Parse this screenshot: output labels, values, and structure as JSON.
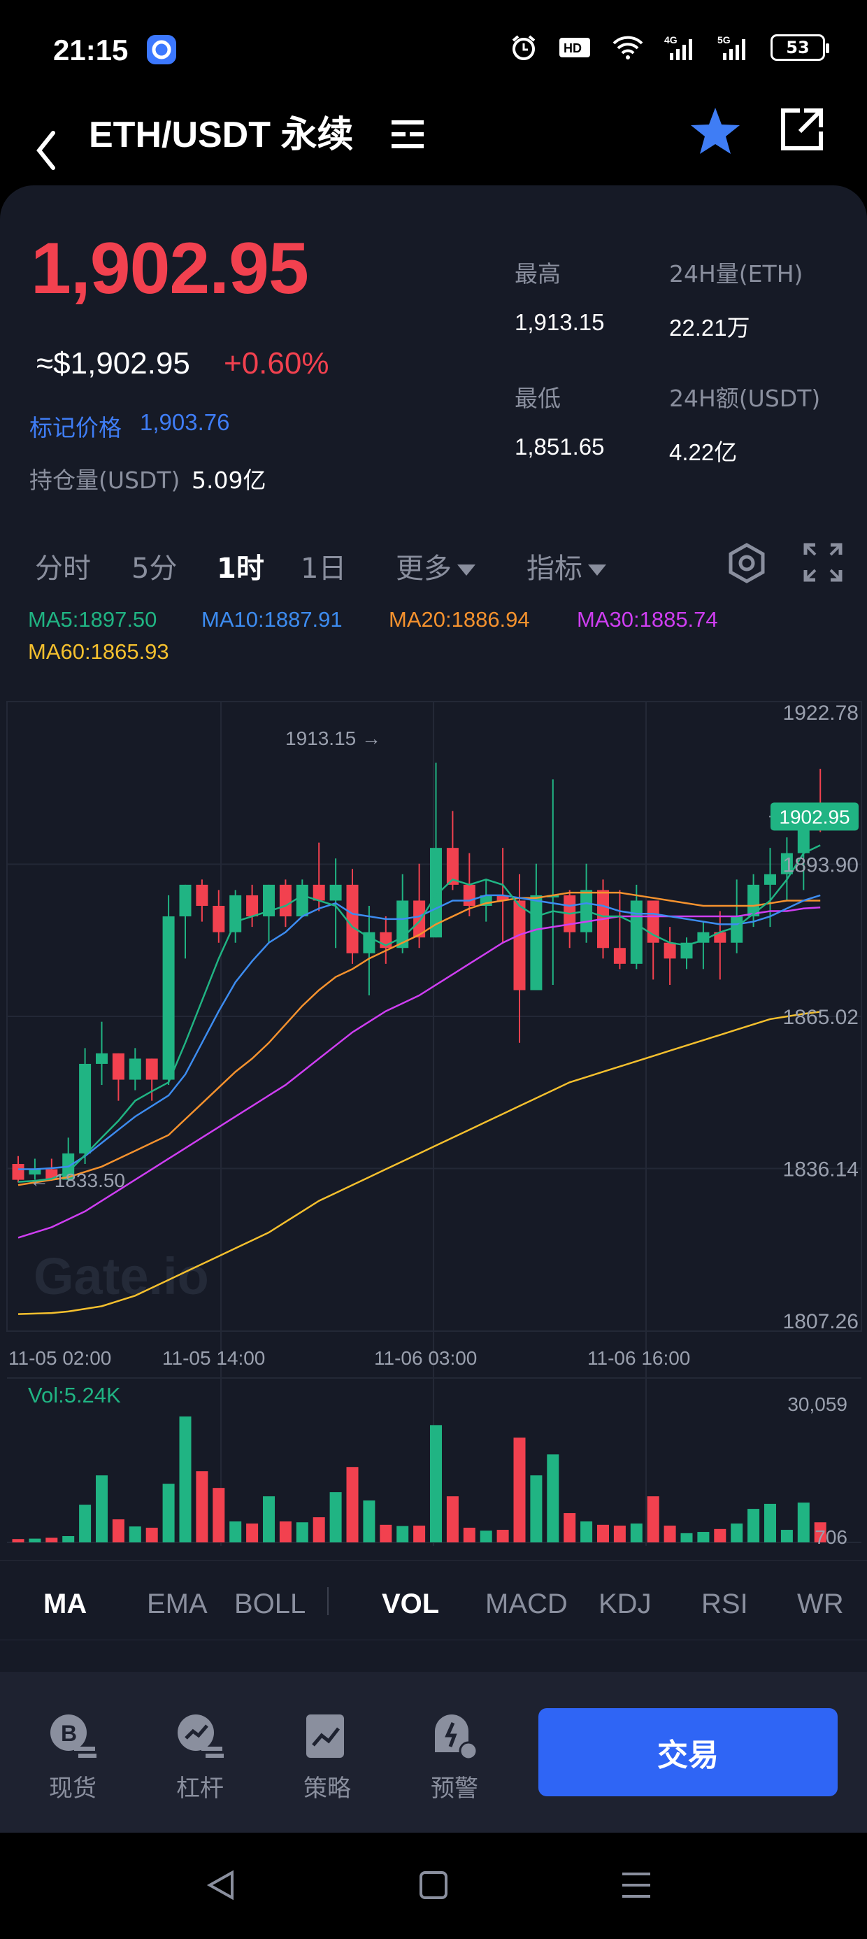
{
  "status_bar": {
    "time": "21:15",
    "battery": "53",
    "indicators": [
      "alarm-icon",
      "hd-icon",
      "wifi-icon",
      "4g-signal-icon",
      "5g-signal-icon"
    ]
  },
  "header": {
    "title": "ETH/USDT 永续",
    "icons": [
      "back-arrow-icon",
      "menu-lines-icon",
      "star-icon",
      "share-icon"
    ]
  },
  "ticker": {
    "last_price": "1,902.95",
    "usd_price": "≈$1,902.95",
    "change_pct": "+0.60%",
    "mark_label": "标记价格",
    "mark_value": "1,903.76",
    "open_interest_label": "持仓量(USDT)",
    "open_interest_value": "5.09亿",
    "high_label": "最高",
    "high_value": "1,913.15",
    "low_label": "最低",
    "low_value": "1,851.65",
    "vol_eth_label": "24H量(ETH)",
    "vol_eth_value": "22.21万",
    "vol_usdt_label": "24H额(USDT)",
    "vol_usdt_value": "4.22亿"
  },
  "periods": {
    "items": [
      "分时",
      "5分",
      "1时",
      "1日"
    ],
    "active": "1时",
    "more": "更多",
    "indicator": "指标"
  },
  "ma_legend": {
    "ma5": "MA5:1897.50",
    "ma10": "MA10:1887.91",
    "ma20": "MA20:1886.94",
    "ma30": "MA30:1885.74",
    "ma60": "MA60:1865.93"
  },
  "chart_data": {
    "type": "candlestick",
    "interval": "1h",
    "watermark": "Gate.io",
    "y_ticks": [
      "1922.78",
      "1893.90",
      "1865.02",
      "1836.14",
      "1807.26"
    ],
    "ylim": [
      1807.26,
      1922.78
    ],
    "x_ticks": [
      "11-05 02:00",
      "11-05 14:00",
      "11-06 03:00",
      "11-06 16:00"
    ],
    "last_price_tag": "1902.95",
    "high_annotation": "1913.15 →",
    "low_annotation": "← 1833.50",
    "colors": {
      "up": "#20b483",
      "down": "#f2414f",
      "ma5": "#20b483",
      "ma10": "#3d8cf0",
      "ma20": "#f5922e",
      "ma30": "#cf3ef2",
      "ma60": "#f5c02e"
    },
    "candles": [
      [
        1837,
        1834,
        1838.5,
        1833.5
      ],
      [
        1835,
        1836,
        1838,
        1834
      ],
      [
        1836,
        1834,
        1838,
        1833.8
      ],
      [
        1834,
        1839,
        1842,
        1833.8
      ],
      [
        1839,
        1856,
        1859,
        1837
      ],
      [
        1856,
        1858,
        1864,
        1852
      ],
      [
        1858,
        1853,
        1858,
        1849
      ],
      [
        1853,
        1857,
        1859,
        1851
      ],
      [
        1857,
        1853,
        1857,
        1849
      ],
      [
        1853,
        1884,
        1888,
        1852
      ],
      [
        1884,
        1890,
        1890,
        1876
      ],
      [
        1890,
        1886,
        1891,
        1883
      ],
      [
        1886,
        1881,
        1889,
        1879
      ],
      [
        1881,
        1888,
        1889,
        1879
      ],
      [
        1888,
        1884,
        1890,
        1882
      ],
      [
        1884,
        1890,
        1890,
        1879
      ],
      [
        1890,
        1884,
        1891,
        1882
      ],
      [
        1884,
        1890,
        1891,
        1884
      ],
      [
        1890,
        1887,
        1898,
        1885
      ],
      [
        1887,
        1890,
        1895,
        1878
      ],
      [
        1890,
        1877,
        1893,
        1875
      ],
      [
        1877,
        1881,
        1886,
        1869
      ],
      [
        1881,
        1878,
        1884,
        1875
      ],
      [
        1878,
        1887,
        1892,
        1877
      ],
      [
        1887,
        1880,
        1894,
        1878
      ],
      [
        1880,
        1897,
        1913.15,
        1880
      ],
      [
        1897,
        1890,
        1904,
        1889
      ],
      [
        1890,
        1886,
        1896,
        1884
      ],
      [
        1886,
        1888,
        1891,
        1883
      ],
      [
        1888,
        1887,
        1897,
        1879
      ],
      [
        1887,
        1870,
        1892,
        1860
      ],
      [
        1870,
        1888,
        1894,
        1872
      ],
      [
        1888,
        1888,
        1910,
        1871
      ],
      [
        1888,
        1881,
        1889,
        1878
      ],
      [
        1881,
        1889,
        1894,
        1879
      ],
      [
        1889,
        1878,
        1891,
        1876
      ],
      [
        1878,
        1875,
        1889,
        1874
      ],
      [
        1875,
        1887,
        1890,
        1874
      ],
      [
        1887,
        1879,
        1887,
        1872
      ],
      [
        1879,
        1876,
        1882,
        1871
      ],
      [
        1876,
        1879,
        1880,
        1874
      ],
      [
        1879,
        1881,
        1883,
        1874
      ],
      [
        1881,
        1879,
        1885,
        1872
      ],
      [
        1879,
        1884,
        1891,
        1877
      ],
      [
        1884,
        1890,
        1892,
        1882
      ],
      [
        1890,
        1892,
        1897,
        1882
      ],
      [
        1892,
        1896,
        1899,
        1887
      ],
      [
        1896,
        1903,
        1904,
        1889
      ],
      [
        1903,
        1901,
        1912,
        1900
      ]
    ],
    "ma5": [
      1833.6,
      1833.8,
      1834.2,
      1835.5,
      1838.7,
      1842.0,
      1845.2,
      1849.0,
      1850.8,
      1852.5,
      1860.0,
      1868.0,
      1876.0,
      1883.0,
      1884.0,
      1885.0,
      1886.0,
      1888.0,
      1887.0,
      1886.0,
      1882.0,
      1880.0,
      1878.5,
      1880.0,
      1883.0,
      1888.0,
      1891.0,
      1890.0,
      1891.0,
      1890.0,
      1886.0,
      1884.0,
      1885.0,
      1884.5,
      1885.0,
      1884.0,
      1884.0,
      1882.5,
      1880.5,
      1879.0,
      1878.5,
      1879.5,
      1881.0,
      1882.0,
      1884.5,
      1887.0,
      1891.0,
      1896.0,
      1897.5
    ],
    "ma10": [
      1836.0,
      1836.0,
      1836.2,
      1836.5,
      1838.5,
      1841.0,
      1843.5,
      1846.0,
      1848.0,
      1850.0,
      1854.0,
      1860.0,
      1866.0,
      1871.5,
      1875.5,
      1879.0,
      1881.0,
      1884.0,
      1885.5,
      1886.5,
      1884.5,
      1884.0,
      1883.5,
      1883.5,
      1884.0,
      1885.5,
      1887.0,
      1887.0,
      1888.0,
      1888.0,
      1887.5,
      1887.0,
      1886.5,
      1886.0,
      1886.5,
      1886.0,
      1885.0,
      1884.5,
      1884.5,
      1884.0,
      1883.5,
      1883.0,
      1882.5,
      1882.5,
      1883.0,
      1884.0,
      1885.5,
      1887.0,
      1888.0
    ],
    "ma20": [
      1833.0,
      1833.5,
      1834.0,
      1834.5,
      1835.5,
      1836.5,
      1838.0,
      1839.5,
      1841.0,
      1842.5,
      1845.5,
      1848.5,
      1851.5,
      1854.5,
      1857.0,
      1860.0,
      1863.5,
      1867.0,
      1870.0,
      1872.5,
      1874.0,
      1876.0,
      1877.5,
      1879.0,
      1880.5,
      1882.5,
      1884.0,
      1885.5,
      1886.5,
      1887.0,
      1887.5,
      1887.5,
      1888.0,
      1888.5,
      1888.5,
      1888.5,
      1888.5,
      1888.0,
      1887.5,
      1887.0,
      1886.5,
      1886.0,
      1886.0,
      1886.0,
      1886.0,
      1886.5,
      1887.0,
      1887.0,
      1887.0
    ],
    "ma30": [
      1823.0,
      1824.0,
      1825.0,
      1826.5,
      1828.0,
      1830.0,
      1832.0,
      1834.0,
      1836.0,
      1838.0,
      1840.0,
      1842.0,
      1844.0,
      1846.0,
      1848.0,
      1850.0,
      1852.0,
      1854.5,
      1857.0,
      1859.5,
      1862.0,
      1864.0,
      1866.0,
      1867.5,
      1869.0,
      1871.0,
      1873.0,
      1875.0,
      1877.0,
      1879.0,
      1880.5,
      1881.5,
      1882.0,
      1882.5,
      1883.0,
      1883.5,
      1884.0,
      1884.0,
      1884.0,
      1884.0,
      1884.0,
      1884.0,
      1884.0,
      1884.0,
      1884.5,
      1885.0,
      1885.0,
      1885.5,
      1885.7
    ],
    "ma60": [
      1808.5,
      1808.6,
      1808.7,
      1809.0,
      1809.5,
      1810.0,
      1811.0,
      1812.0,
      1813.5,
      1815.0,
      1816.5,
      1818.0,
      1819.5,
      1821.0,
      1822.5,
      1824.0,
      1826.0,
      1828.0,
      1830.0,
      1831.5,
      1833.0,
      1834.5,
      1836.0,
      1837.5,
      1839.0,
      1840.5,
      1842.0,
      1843.5,
      1845.0,
      1846.5,
      1848.0,
      1849.5,
      1851.0,
      1852.5,
      1853.5,
      1854.5,
      1855.5,
      1856.5,
      1857.5,
      1858.5,
      1859.5,
      1860.5,
      1861.5,
      1862.5,
      1863.5,
      1864.5,
      1865.0,
      1865.5,
      1865.9
    ],
    "volume": {
      "label": "Vol:5.24K",
      "y_ticks": [
        "30,059",
        "706"
      ],
      "values": [
        800,
        900,
        1100,
        1500,
        9000,
        16000,
        5500,
        3800,
        3500,
        14000,
        30059,
        17000,
        13000,
        5000,
        4500,
        11000,
        5000,
        4800,
        6000,
        12000,
        18000,
        10000,
        4200,
        3900,
        4000,
        28000,
        11000,
        3500,
        2800,
        3000,
        25000,
        16000,
        21000,
        7000,
        5000,
        4200,
        4000,
        4500,
        11000,
        4000,
        2200,
        2500,
        3200,
        4500,
        8000,
        9200,
        3000,
        9500,
        4800
      ]
    }
  },
  "indicator_tabs": {
    "main": [
      "MA",
      "EMA",
      "BOLL"
    ],
    "sub": [
      "VOL",
      "MACD",
      "KDJ",
      "RSI",
      "WR"
    ],
    "active_main": "MA",
    "active_sub": "VOL"
  },
  "bottom_nav": {
    "items": [
      {
        "label": "现货",
        "icon": "spot-coin-icon"
      },
      {
        "label": "杠杆",
        "icon": "margin-icon"
      },
      {
        "label": "策略",
        "icon": "strategy-icon"
      },
      {
        "label": "预警",
        "icon": "alert-icon"
      }
    ],
    "trade_button": "交易"
  },
  "system_nav": {
    "buttons": [
      "back-triangle-icon",
      "home-square-icon",
      "recents-lines-icon"
    ]
  }
}
